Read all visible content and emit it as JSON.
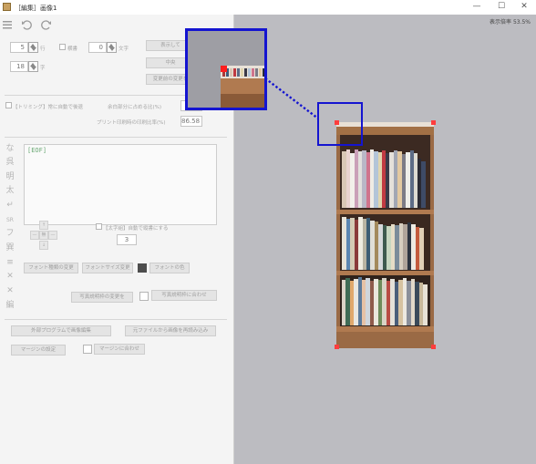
{
  "window": {
    "title": "［編集］画像1",
    "minimize_glyph": "—",
    "maximize_glyph": "☐",
    "close_glyph": "✕"
  },
  "toolbar": {
    "menu_icon": "hamburger-icon",
    "undo_icon": "undo-icon",
    "redo_icon": "redo-icon"
  },
  "settings": {
    "value_1": "5",
    "unit_1": "行",
    "value_2": "18",
    "unit_2": "字",
    "horizontal_label": "横書",
    "value_3": "0",
    "unit_3": "文字"
  },
  "side_buttons": {
    "display_label": "表示して",
    "center_label": "中央",
    "before_change_label": "変更前の変更を"
  },
  "trimming": {
    "auto_trim_label": "【トリミング】常に自動で後退",
    "blank_ratio_label": "余白部分に占める比(%)",
    "blank_ratio_value": "",
    "print_ratio_label": "プリント印刷時の印刷比率(%)",
    "print_ratio_value": "86.58"
  },
  "editor": {
    "content": "[EOF]"
  },
  "vertical_tools": [
    "な",
    "呉",
    "明",
    "太",
    "↵",
    "SR",
    "フ",
    "巽",
    "≡",
    "✕",
    "✕",
    "編"
  ],
  "dpad": {
    "up": "↑",
    "left": "—",
    "center": "無",
    "right": "—",
    "down": "↓"
  },
  "text_settings": {
    "auto_tate_label": "【太字組】自動で縦書にする",
    "auto_tate_value": "3"
  },
  "font_buttons": {
    "font_type_label": "フォント種類の変更",
    "font_size_label": "フォントサイズ変更",
    "font_color_label": "フォントの色"
  },
  "photo_buttons": {
    "change_desc_label": "写真説明枠の変更を",
    "match_desc_label": "写真説明枠に合わせ"
  },
  "bottom_buttons": {
    "external_edit_label": "外部プログラムで画像編集",
    "reload_label": "元ファイルから画像を再読み込み",
    "margin_setting_label": "マージンの設定",
    "margin_fit_label": "マージンに合わせ"
  },
  "preview": {
    "zoom_label": "表示倍率 53.5%"
  },
  "colors": {
    "accent_blue": "#1414d0",
    "handle_red": "#ff3d3d",
    "canvas_bg": "#bcbcc1"
  }
}
